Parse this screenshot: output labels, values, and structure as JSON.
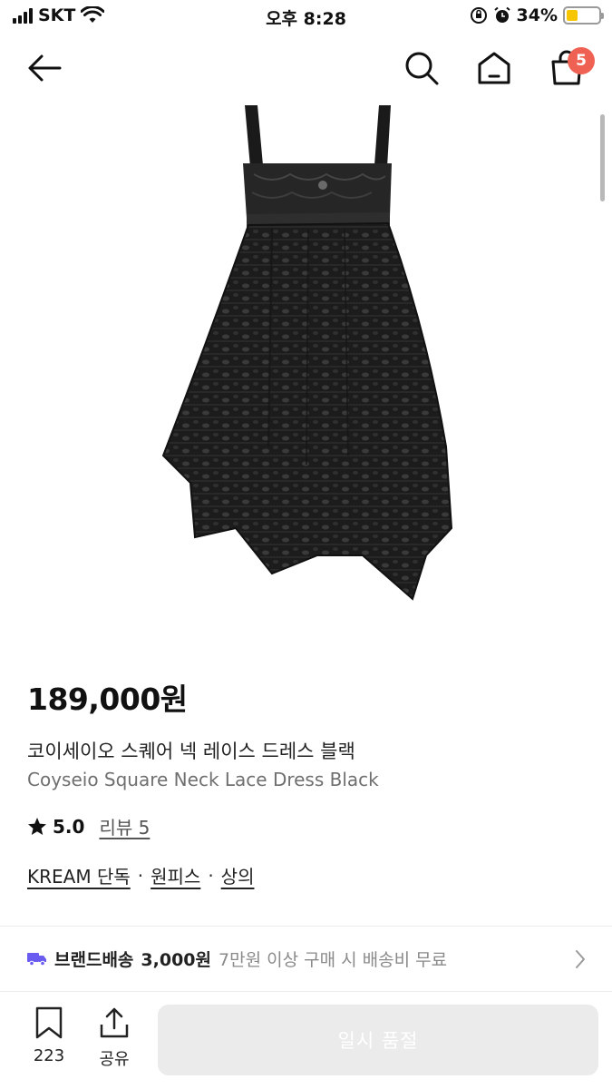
{
  "status_bar": {
    "carrier": "SKT",
    "time": "오후 8:28",
    "battery_percent": "34%",
    "battery_level": 0.34
  },
  "nav": {
    "cart_count": "5"
  },
  "product": {
    "price": "189,000원",
    "name_ko": "코이세이오 스퀘어 넥 레이스 드레스 블랙",
    "name_en": "Coyseio Square Neck Lace Dress Black",
    "rating": "5.0",
    "review_label": "리뷰 5",
    "tags": [
      "KREAM 단독",
      "원피스",
      "상의"
    ]
  },
  "delivery": {
    "label": "브랜드배송",
    "fee": "3,000원",
    "condition": "7만원 이상 구매 시 배송비 무료"
  },
  "bottom_bar": {
    "bookmark_count": "223",
    "share_label": "공유",
    "action_label": "일시 품절"
  },
  "colors": {
    "badge": "#ef6253",
    "battery": "#f7c600",
    "delivery_truck": "#6a5cf0",
    "soldout_button": "#ebebeb"
  }
}
